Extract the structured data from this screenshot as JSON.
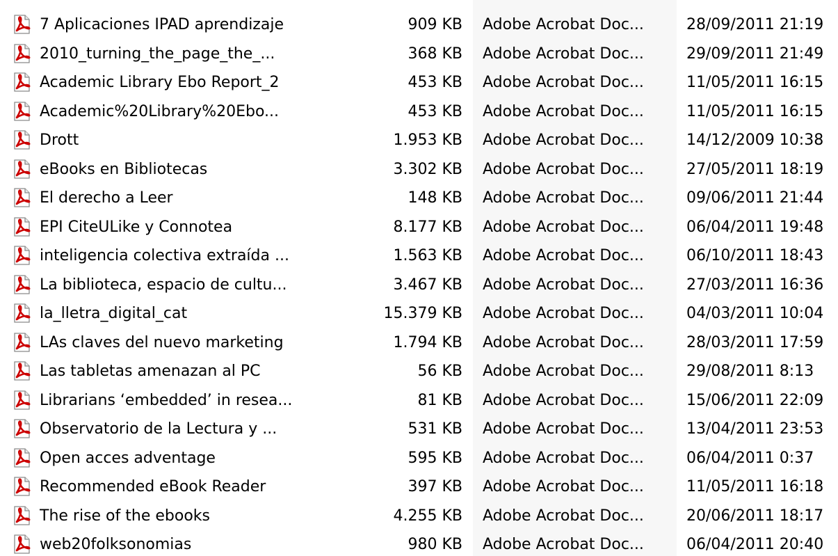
{
  "window": {
    "title": "",
    "accent_color": "#cc0000"
  },
  "file_list": {
    "icon_name": "pdf-file-icon",
    "rows": [
      {
        "name": "7 Aplicaciones IPAD aprendizaje",
        "size": "909 KB",
        "type": "Adobe Acrobat Doc...",
        "date": "28/09/2011 21:19"
      },
      {
        "name": "2010_turning_the_page_the_...",
        "size": "368 KB",
        "type": "Adobe Acrobat Doc...",
        "date": "29/09/2011 21:49"
      },
      {
        "name": "Academic Library Ebo Report_2",
        "size": "453 KB",
        "type": "Adobe Acrobat Doc...",
        "date": "11/05/2011 16:15"
      },
      {
        "name": "Academic%20Library%20Ebo...",
        "size": "453 KB",
        "type": "Adobe Acrobat Doc...",
        "date": "11/05/2011 16:15"
      },
      {
        "name": "Drott",
        "size": "1.953 KB",
        "type": "Adobe Acrobat Doc...",
        "date": "14/12/2009 10:38"
      },
      {
        "name": "eBooks en Bibliotecas",
        "size": "3.302 KB",
        "type": "Adobe Acrobat Doc...",
        "date": "27/05/2011 18:19"
      },
      {
        "name": "El derecho a Leer",
        "size": "148 KB",
        "type": "Adobe Acrobat Doc...",
        "date": "09/06/2011 21:44"
      },
      {
        "name": "EPI CiteULike y Connotea",
        "size": "8.177 KB",
        "type": "Adobe Acrobat Doc...",
        "date": "06/04/2011 19:48"
      },
      {
        "name": "inteligencia colectiva extraída ...",
        "size": "1.563 KB",
        "type": "Adobe Acrobat Doc...",
        "date": "06/10/2011 18:43"
      },
      {
        "name": "La biblioteca, espacio de cultu...",
        "size": "3.467 KB",
        "type": "Adobe Acrobat Doc...",
        "date": "27/03/2011 16:36"
      },
      {
        "name": "la_lletra_digital_cat",
        "size": "15.379 KB",
        "type": "Adobe Acrobat Doc...",
        "date": "04/03/2011 10:04"
      },
      {
        "name": "LAs claves del nuevo marketing",
        "size": "1.794 KB",
        "type": "Adobe Acrobat Doc...",
        "date": "28/03/2011 17:59"
      },
      {
        "name": "Las tabletas amenazan al PC",
        "size": "56 KB",
        "type": "Adobe Acrobat Doc...",
        "date": "29/08/2011 8:13"
      },
      {
        "name": "Librarians ‘embedded’ in resea...",
        "size": "81 KB",
        "type": "Adobe Acrobat Doc...",
        "date": "15/06/2011 22:09"
      },
      {
        "name": "Observatorio de la Lectura y ...",
        "size": "531 KB",
        "type": "Adobe Acrobat Doc...",
        "date": "13/04/2011 23:53"
      },
      {
        "name": "Open acces adventage",
        "size": "595 KB",
        "type": "Adobe Acrobat Doc...",
        "date": "06/04/2011 0:37"
      },
      {
        "name": "Recommended eBook Reader",
        "size": "397 KB",
        "type": "Adobe Acrobat Doc...",
        "date": "11/05/2011 16:18"
      },
      {
        "name": "The rise of the ebooks",
        "size": "4.255 KB",
        "type": "Adobe Acrobat Doc...",
        "date": "20/06/2011 18:17"
      },
      {
        "name": "web20folksonomias",
        "size": "980 KB",
        "type": "Adobe Acrobat Doc...",
        "date": "06/04/2011 20:40"
      }
    ]
  }
}
